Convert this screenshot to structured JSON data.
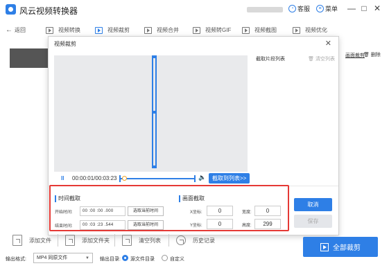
{
  "app": {
    "title": "风云视频转换器",
    "service_label": "客服",
    "menu_label": "菜单",
    "minimize": "—",
    "maximize": "□",
    "close": "✕"
  },
  "toolbar": {
    "back_label": "返回",
    "items": [
      {
        "label": "视频转换",
        "active": false
      },
      {
        "label": "视频裁剪",
        "active": true
      },
      {
        "label": "视频合并",
        "active": false
      },
      {
        "label": "视频转GIF",
        "active": false
      },
      {
        "label": "视频截图",
        "active": false
      },
      {
        "label": "视频优化",
        "active": false
      }
    ]
  },
  "file_row": {
    "link_crop": "画面裁剪",
    "delete": "删除"
  },
  "dialog": {
    "title": "视频裁剪",
    "close": "✕",
    "clip_list_title": "截取片段列表",
    "clear_list": "清空列表",
    "player": {
      "pause": "II",
      "time": "00:00:01/00:03:23",
      "progress": 0.005,
      "volume_icon": "🔈",
      "add_to_list": "截取到列表>>"
    },
    "time_crop": {
      "title": "时间截取",
      "start_label": "开始时间:",
      "start_value": "00 :00 :00 .000",
      "start_pick": "选取当前时间",
      "end_label": "结束时间:",
      "end_value": "00 :03 :23 .544",
      "end_pick": "选取当前时间"
    },
    "frame_crop": {
      "title": "画面截取",
      "x_label": "X坐标:",
      "x_value": "0",
      "y_label": "Y坐标:",
      "y_value": "0",
      "width_label": "宽度:",
      "width_value": "0",
      "height_label": "高度:",
      "height_value": "299"
    },
    "cancel": "取消",
    "save": "保存"
  },
  "bottom": {
    "add_file": "添加文件",
    "add_folder": "添加文件夹",
    "clear_list": "清空列表",
    "history": "历史记录",
    "crop_all": "全部裁剪",
    "output_format_label": "输出格式:",
    "output_format_value": "MP4 同原文件",
    "output_dir_label": "输出目录:",
    "dir_source": "源文件目录",
    "dir_custom": "自定义"
  },
  "colors": {
    "accent": "#2e7fe6",
    "highlight_border": "#e53935"
  }
}
